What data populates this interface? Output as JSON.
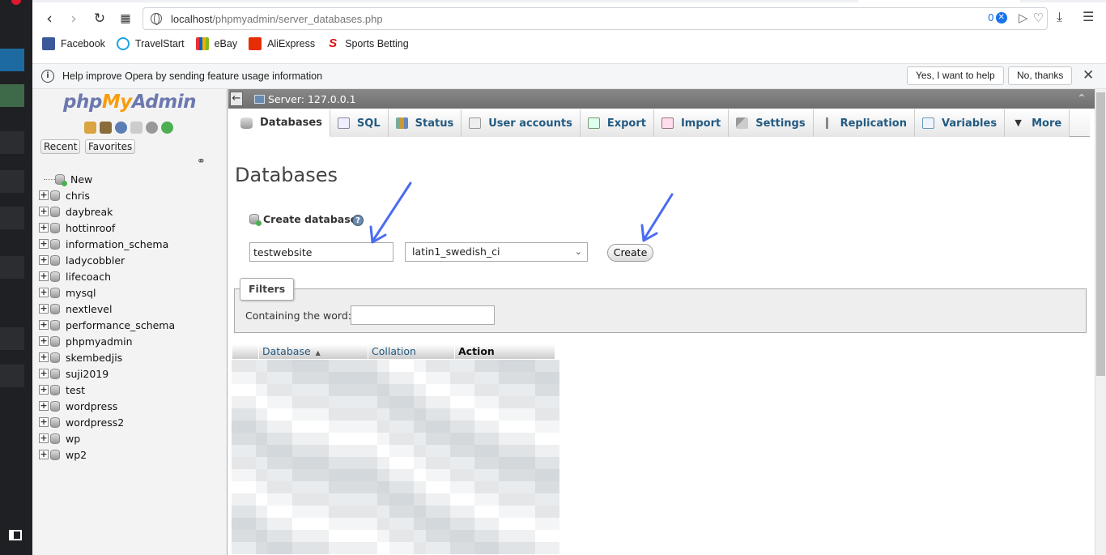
{
  "browser": {
    "url_host": "localhost",
    "url_path": "/phpmyadmin/server_databases.php",
    "adblock_count": "0",
    "bookmarks": [
      {
        "label": "Facebook",
        "icon": "facebook-icon",
        "color": "#3b5998"
      },
      {
        "label": "TravelStart",
        "icon": "travelstart-icon",
        "color": "#1aa3e0"
      },
      {
        "label": "eBay",
        "icon": "ebay-icon",
        "color": "#e53238"
      },
      {
        "label": "AliExpress",
        "icon": "aliexpress-icon",
        "color": "#e62e04"
      },
      {
        "label": "Sports Betting",
        "icon": "sports-betting-icon",
        "color": "#d11"
      }
    ],
    "infobar": {
      "text": "Help improve Opera by sending feature usage information",
      "accept_label": "Yes, I want to help",
      "decline_label": "No, thanks"
    }
  },
  "nav": {
    "logo": {
      "php": "php",
      "my": "My",
      "admin": "Admin"
    },
    "recent_label": "Recent",
    "favorites_label": "Favorites",
    "new_label": "New",
    "databases": [
      "chris",
      "daybreak",
      "hottinroof",
      "information_schema",
      "ladycobbler",
      "lifecoach",
      "mysql",
      "nextlevel",
      "performance_schema",
      "phpmyadmin",
      "skembedjis",
      "suji2019",
      "test",
      "wordpress",
      "wordpress2",
      "wp",
      "wp2"
    ]
  },
  "server": {
    "label": "Server: 127.0.0.1"
  },
  "tabs": [
    {
      "label": "Databases",
      "icon": "databases-icon",
      "active": true
    },
    {
      "label": "SQL",
      "icon": "sql-icon"
    },
    {
      "label": "Status",
      "icon": "status-icon"
    },
    {
      "label": "User accounts",
      "icon": "user-accounts-icon"
    },
    {
      "label": "Export",
      "icon": "export-icon"
    },
    {
      "label": "Import",
      "icon": "import-icon"
    },
    {
      "label": "Settings",
      "icon": "settings-icon"
    },
    {
      "label": "Replication",
      "icon": "replication-icon"
    },
    {
      "label": "Variables",
      "icon": "variables-icon"
    },
    {
      "label": "More",
      "icon": "chevron-down-icon"
    }
  ],
  "page": {
    "title": "Databases",
    "create_label": "Create database",
    "db_name_value": "testwebsite",
    "collation_value": "latin1_swedish_ci",
    "create_button": "Create",
    "filters_legend": "Filters",
    "filter_label": "Containing the word:",
    "filter_value": "",
    "table_headers": {
      "database": "Database",
      "collation": "Collation",
      "action": "Action"
    }
  },
  "colors": {
    "accent": "#235a81",
    "arrow": "#4a6cf0"
  }
}
